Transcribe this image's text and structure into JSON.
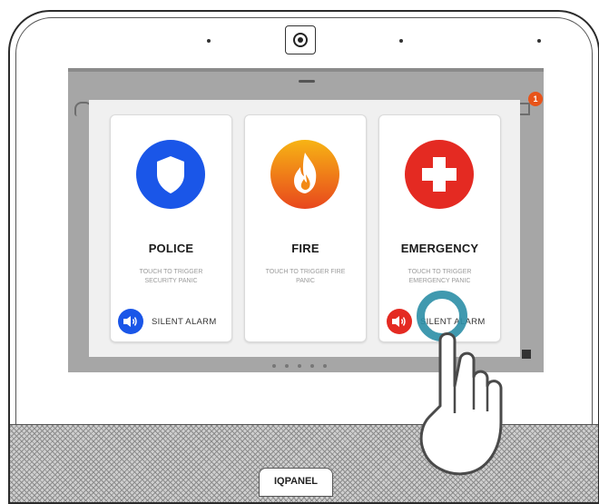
{
  "device": {
    "brand_logo_text": "IQPANEL"
  },
  "status": {
    "notification_count": "1"
  },
  "panic_cards": [
    {
      "title": "POLICE",
      "subtitle": "TOUCH TO TRIGGER SECURITY PANIC",
      "icon": "shield-icon",
      "icon_color": "#1a56e8",
      "silent_label": "SILENT ALARM",
      "silent_icon": "speaker-icon",
      "silent_color": "#1a56e8"
    },
    {
      "title": "FIRE",
      "subtitle": "TOUCH TO TRIGGER FIRE PANIC",
      "icon": "flame-icon",
      "icon_color": "#f28a16"
    },
    {
      "title": "EMERGENCY",
      "subtitle": "TOUCH TO TRIGGER EMERGENCY PANIC",
      "icon": "medical-cross-icon",
      "icon_color": "#e42a22",
      "silent_label": "SILENT ALARM",
      "silent_icon": "speaker-icon",
      "silent_color": "#e42a22"
    }
  ],
  "colors": {
    "touch_ring": "#2b8ea6",
    "screen_bg": "#a6a6a6",
    "modal_bg": "#f0f0f0"
  }
}
